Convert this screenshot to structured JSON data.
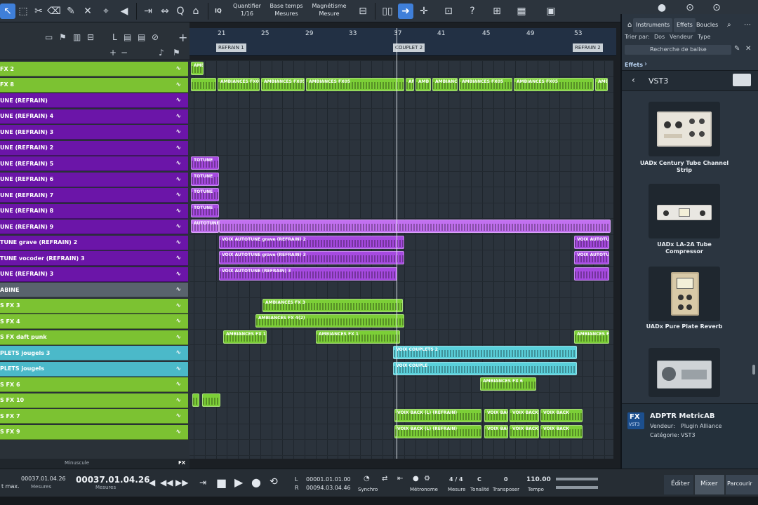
{
  "toolbar": {
    "quantize_label": "Quantifier",
    "quantize_value": "1/16",
    "timebase_label": "Base temps",
    "timebase_value": "Mesures",
    "snap_label": "Magnétisme",
    "snap_value": "Mesure",
    "iq_label": "IQ"
  },
  "ruler": {
    "bars": [
      "21",
      "25",
      "29",
      "33",
      "37",
      "41",
      "45",
      "49",
      "53"
    ],
    "markers": [
      "REFRAIN 1",
      "COUPLET 2",
      "REFRAIN 2"
    ]
  },
  "tracks": [
    {
      "name": "FX 2",
      "color": "#7cc232"
    },
    {
      "name": "FX 8",
      "color": "#7cc232"
    },
    {
      "name": "UNE  (REFRAIN)",
      "color": "#6b15a8"
    },
    {
      "name": "UNE  (REFRAIN) 4",
      "color": "#6b15a8"
    },
    {
      "name": "UNE  (REFRAIN) 3",
      "color": "#6b15a8"
    },
    {
      "name": "UNE  (REFRAIN) 2",
      "color": "#6b15a8"
    },
    {
      "name": "UNE  (REFRAIN) 5",
      "color": "#6b15a8"
    },
    {
      "name": "UNE  (REFRAIN) 6",
      "color": "#6b15a8"
    },
    {
      "name": "UNE  (REFRAIN) 7",
      "color": "#6b15a8"
    },
    {
      "name": "UNE  (REFRAIN) 8",
      "color": "#6b15a8"
    },
    {
      "name": "UNE  (REFRAIN) 9",
      "color": "#6b15a8"
    },
    {
      "name": "TUNE grave  (REFRAIN)  2",
      "color": "#6b15a8"
    },
    {
      "name": "TUNE vocoder  (REFRAIN)  3",
      "color": "#6b15a8"
    },
    {
      "name": "UNE  (REFRAIN)  3",
      "color": "#6b15a8"
    },
    {
      "name": "ABINE",
      "color": "#59636d"
    },
    {
      "name": "S FX 3",
      "color": "#7cc232"
    },
    {
      "name": "S FX 4",
      "color": "#7cc232"
    },
    {
      "name": "S FX  daft punk",
      "color": "#7cc232"
    },
    {
      "name": "PLETS  jougels 3",
      "color": "#4bb9c9"
    },
    {
      "name": "PLETS  jougels",
      "color": "#4bb9c9"
    },
    {
      "name": "S FX 6",
      "color": "#7cc232"
    },
    {
      "name": "S FX 10",
      "color": "#7cc232"
    },
    {
      "name": "S FX 7",
      "color": "#7cc232"
    },
    {
      "name": "S FX 9",
      "color": "#7cc232"
    }
  ],
  "clip_labels": {
    "ambiances_fx05": "AMBIANCES FX05",
    "ambiances": "AMBIANCES",
    "amb": "AMB",
    "autotune": "AUTOTUNE",
    "totune": "TOTUNE",
    "voix_grave": "VOIX AUTOTUNE grave (REFRAIN) 2",
    "voix_vocoder": "VOIX AUTOTUNE grave (REFRAIN) 3",
    "voix_autotune": "VOIX AUTOTUNE (REFRAIN) 3",
    "voix_autotu": "VOIX AUTOTU",
    "ambiances_fx3": "AMBIANCES FX 3",
    "ambiances_fx4": "AMBIANCES FX 4(2)",
    "ambiances_fx": "AMBIANCES FX 1",
    "voix_couplets": "VOIX COUPLETS 2",
    "voix_couple": "VOIX COUPLE",
    "ambiances_fx6": "AMBIANCES FX 6",
    "voix_back": "VOIX BACK (L) (REFRAIN)",
    "voix_back2": "VOIX BACK"
  },
  "header": {
    "minuscule": "Minuscule",
    "fx_label": "FX"
  },
  "browser": {
    "tabs": [
      "Instruments",
      "Effets",
      "Boucles"
    ],
    "sort_label": "Trier par:",
    "sort_options": [
      "Dos",
      "Vendeur",
      "Type"
    ],
    "search_placeholder": "Recherche de balise",
    "breadcrumb": "Effets",
    "folder": "VST3",
    "plugins": [
      {
        "name": "UADx Century Tube Channel Strip"
      },
      {
        "name": "UADx LA-2A Tube Compressor"
      },
      {
        "name": "UADx Pure Plate Reverb"
      },
      {
        "name": ""
      }
    ],
    "selected": {
      "badge": "FX",
      "badge_sub": "VST3",
      "name": "ADPTR MetricAB",
      "vendor_label": "Vendeur:",
      "vendor": "Plugin Alliance",
      "category_label": "Catégorie:",
      "category": "VST3"
    }
  },
  "transport": {
    "max_label": "t max.",
    "pos_small": "00037.01.04.26",
    "pos_small_label": "Mesures",
    "pos_big": "00037.01.04.26",
    "pos_big_label": "Mesures",
    "loop_l_flag": "L",
    "loop_r_flag": "R",
    "loop_l": "00001.01.01.00",
    "loop_r": "00094.03.04.46",
    "sync": "Synchro",
    "metronome": "Métronome",
    "signature": "4 / 4",
    "signature_label": "Mesure",
    "key": "C",
    "key_label": "Tonalité",
    "transpose": "0",
    "transpose_label": "Transposer",
    "tempo": "110.00",
    "tempo_label": "Tempo",
    "edit_tab": "Éditer",
    "mix_tab": "Mixer",
    "browse_tab": "Parcourir"
  }
}
